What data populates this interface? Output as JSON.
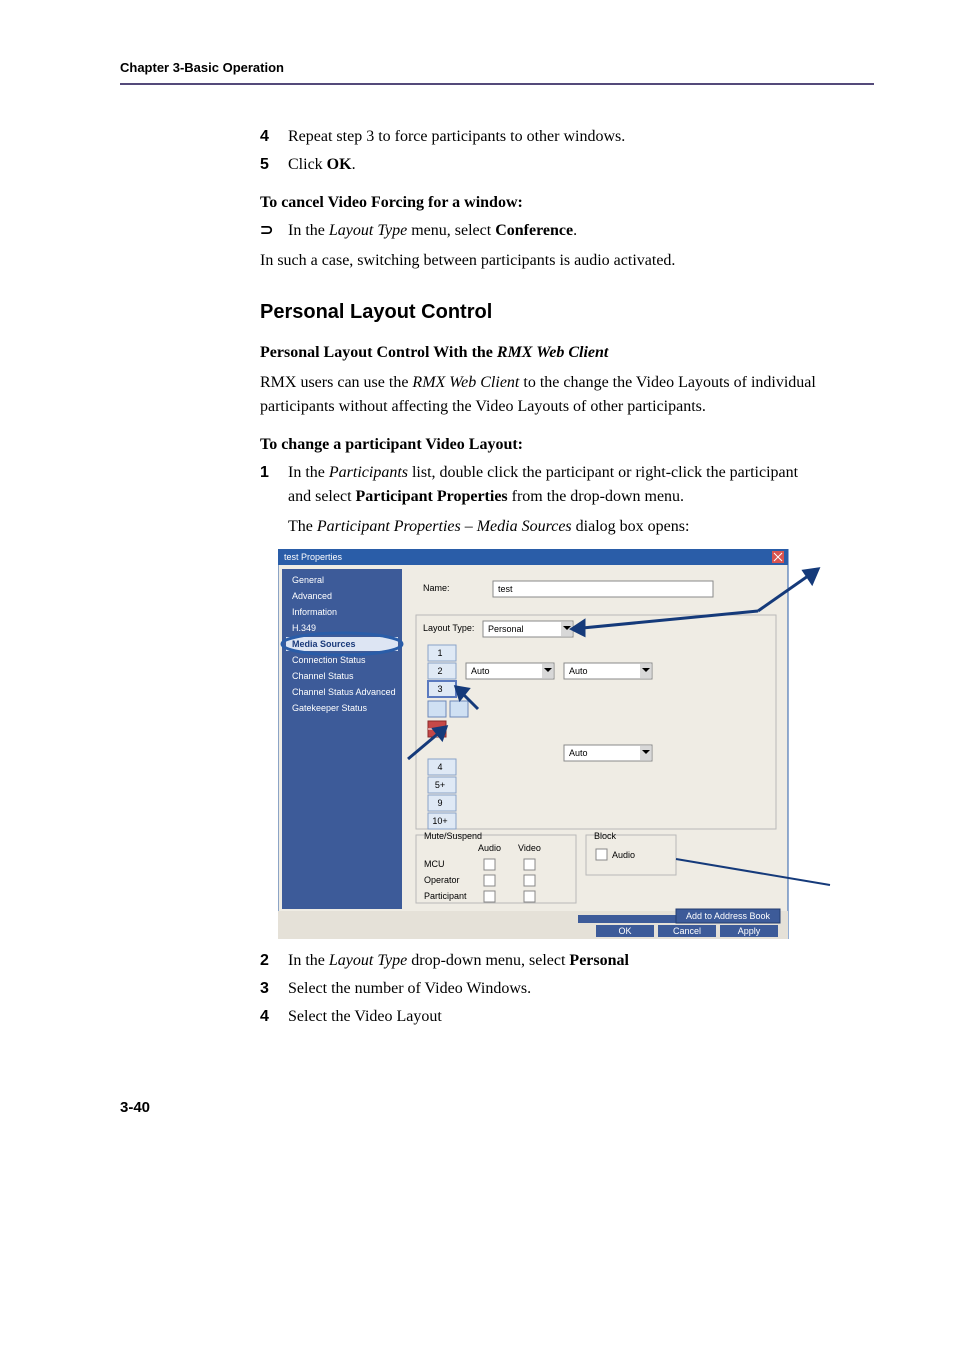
{
  "header": {
    "chapter": "Chapter 3-Basic Operation"
  },
  "steps1": [
    {
      "n": "4",
      "text": "Repeat step 3 to force participants to other windows."
    },
    {
      "n": "5",
      "prefix": "Click ",
      "bold": "OK",
      "suffix": "."
    }
  ],
  "cancel": {
    "heading": "To cancel Video Forcing for a window:",
    "bullet": {
      "sym": "⊃",
      "prefix": "In the ",
      "italic": "Layout Type",
      "mid": " menu, select ",
      "bold": "Conference",
      "suffix": "."
    },
    "note": "In such a case, switching between participants is audio activated."
  },
  "section": {
    "title": "Personal Layout Control",
    "subhead_pre": "Personal Layout Control With the ",
    "subhead_it": "RMX Web Client",
    "p1_a": "RMX users can use the ",
    "p1_it": "RMX Web Client",
    "p1_b": " to the change the Video Layouts of individual participants without affecting the Video Layouts of other participants.",
    "change_h": "To change a participant Video Layout:",
    "s1": {
      "n": "1",
      "a": "In the ",
      "it": "Participants",
      "b": " list, double click the participant or right-click the participant and select ",
      "bold": "Participant Properties",
      "c": " from the drop-down menu."
    },
    "caption_a": "The ",
    "caption_it": "Participant Properties – Media Sources",
    "caption_b": " dialog box opens:",
    "s2": {
      "n": "2",
      "a": "In the ",
      "it": "Layout Type",
      "b": " drop-down menu, select ",
      "bold": "Personal"
    },
    "s3": {
      "n": "3",
      "text": "Select the number of Video Windows."
    },
    "s4": {
      "n": "4",
      "text": "Select the Video Layout"
    }
  },
  "dialog": {
    "title": "test Properties",
    "sidebar": [
      "General",
      "Advanced",
      "Information",
      "H.349",
      "Media Sources",
      "Connection Status",
      "Channel Status",
      "Channel Status Advanced",
      "Gatekeeper Status"
    ],
    "name_label": "Name:",
    "name_value": "test",
    "layout_type_label": "Layout Type:",
    "layout_type_value": "Personal",
    "numbers": [
      "1",
      "2",
      "3",
      "4",
      "5+",
      "9",
      "10+"
    ],
    "auto": "Auto",
    "mute_group": "Mute/Suspend",
    "mute_cols": [
      "Audio",
      "Video"
    ],
    "mute_rows": [
      "MCU",
      "Operator",
      "Participant"
    ],
    "block_group": "Block",
    "block_item": "Audio",
    "buttons": {
      "add": "Add to Address Book",
      "ok": "OK",
      "cancel": "Cancel",
      "apply": "Apply"
    }
  },
  "pagenum": "3-40"
}
